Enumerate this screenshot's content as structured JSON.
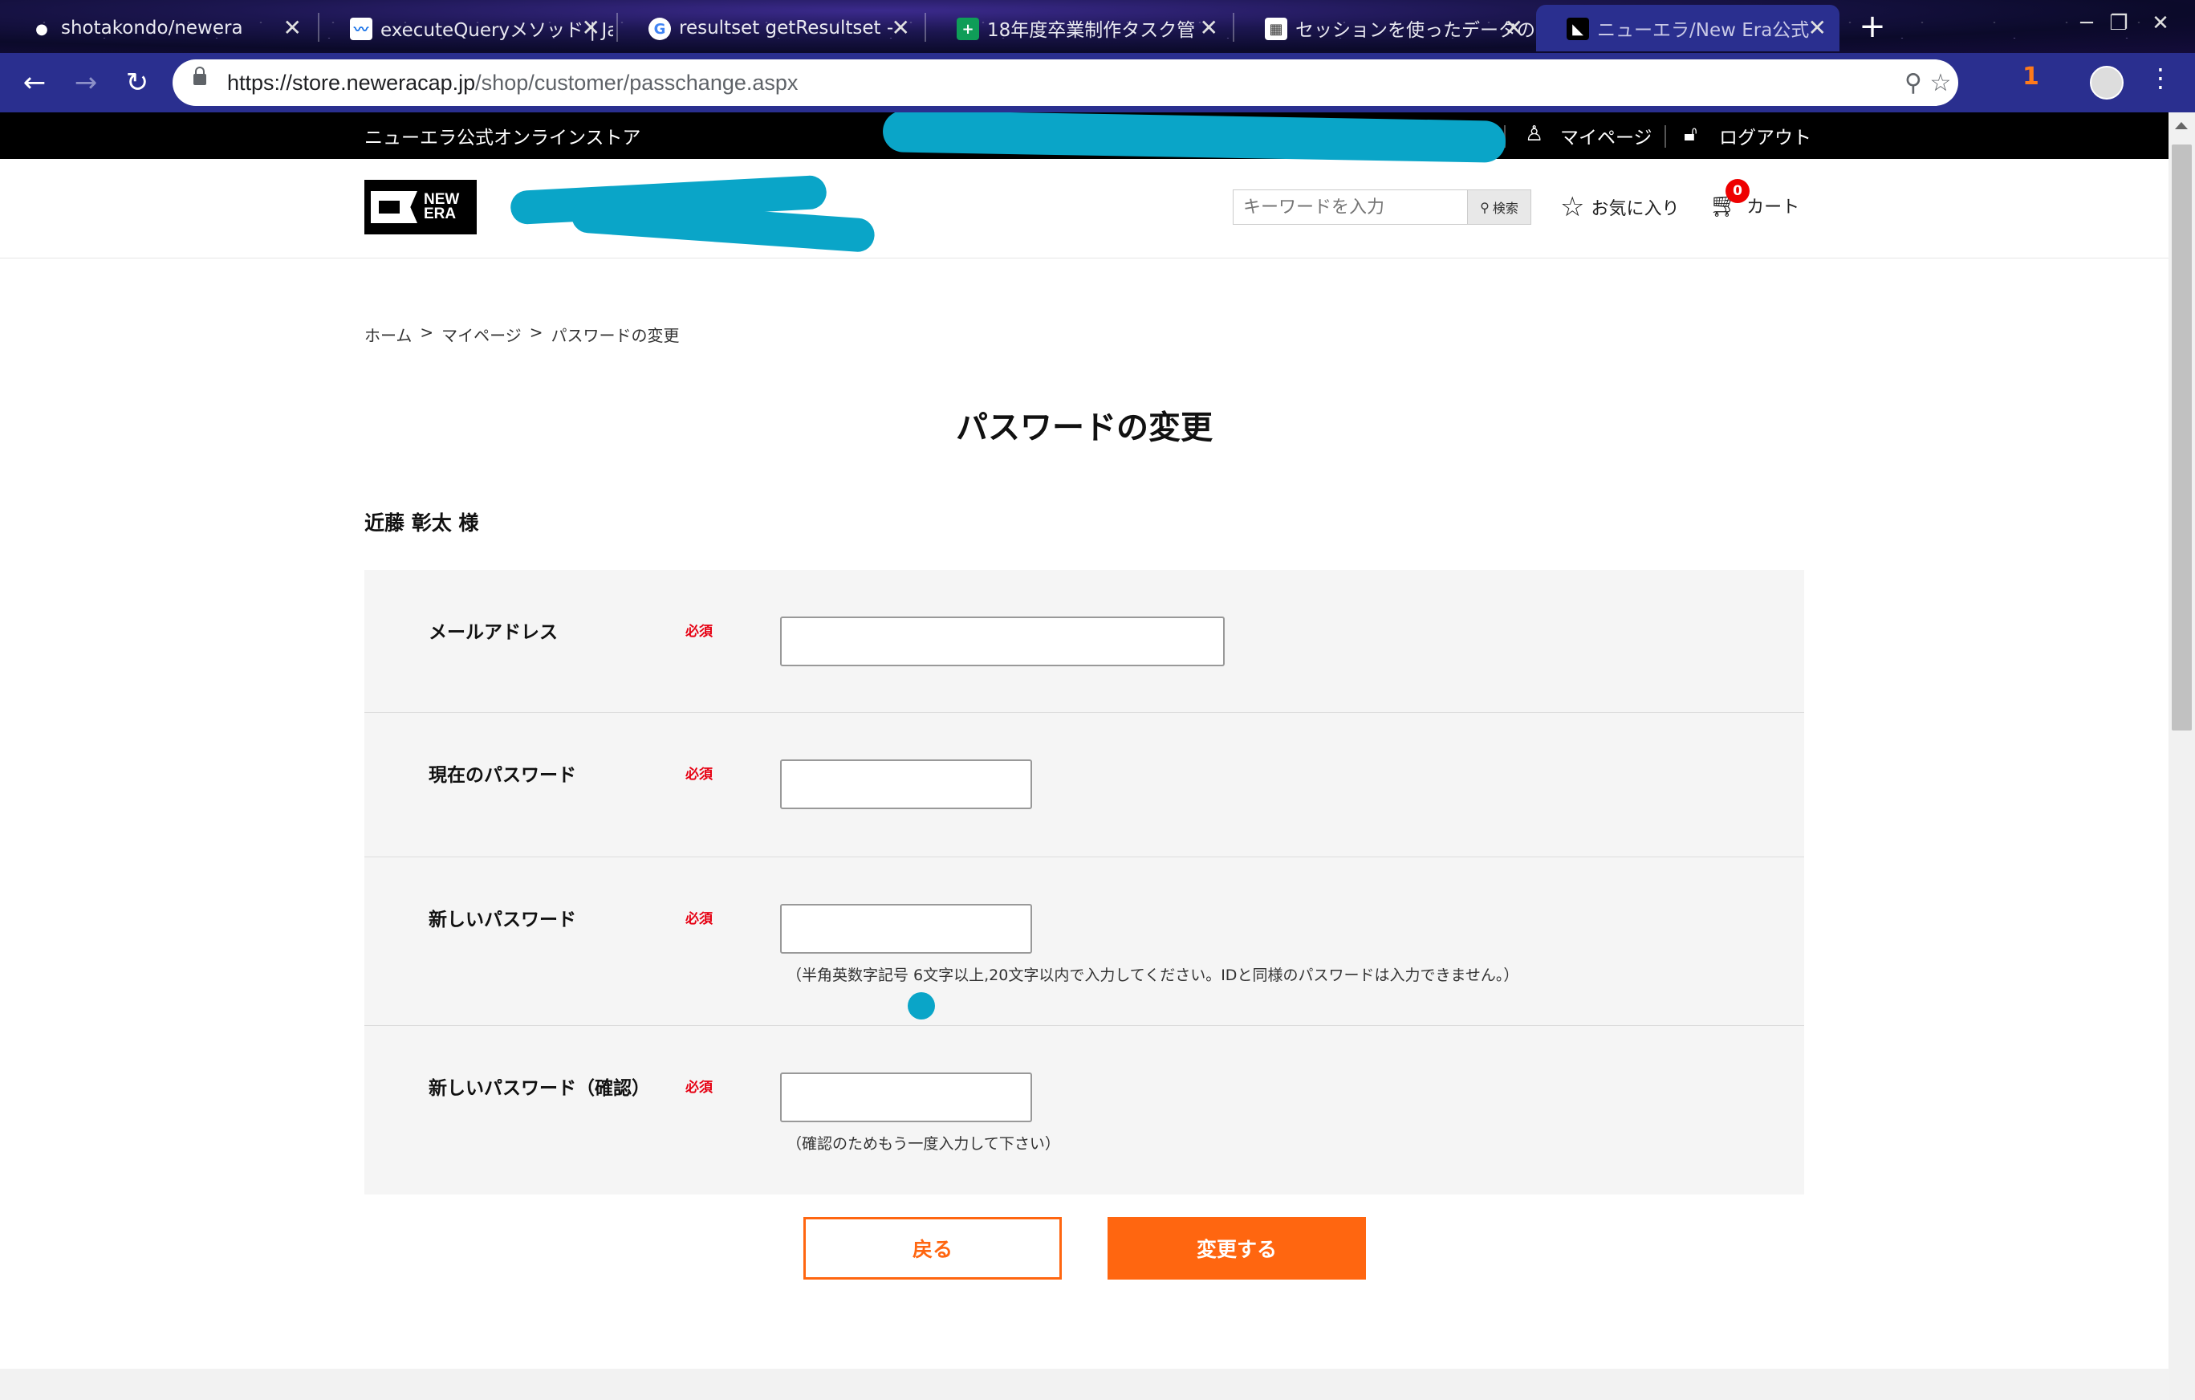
{
  "browser": {
    "tabs": [
      {
        "title": "shotakondo/newera",
        "favicon": "github-icon",
        "favicon_color": "#ffffff",
        "active": false
      },
      {
        "title": "executeQueryメソッド | Ja",
        "favicon": "chart-icon",
        "favicon_color": "#1a73e8",
        "active": false
      },
      {
        "title": "resultset getResultset -",
        "favicon": "google-icon",
        "favicon_color": "#4285f4",
        "active": false
      },
      {
        "title": "18年度卒業制作タスク管",
        "favicon": "sheets-icon",
        "favicon_color": "#0f9d58",
        "active": false
      },
      {
        "title": "セッションを使ったデータの",
        "favicon": "grid-icon",
        "favicon_color": "#ffffff",
        "active": false
      },
      {
        "title": "ニューエラ/New Era公式",
        "favicon": "newera-icon",
        "favicon_color": "#000000",
        "active": true
      }
    ],
    "url_host": "https://store.neweracap.jp",
    "url_path": "/shop/customer/passchange.aspx",
    "extension_badge": "1"
  },
  "site": {
    "store_name": "ニューエラ公式オンラインストア",
    "mypage": "マイページ",
    "logout": "ログアウト",
    "logo_text_top": "NEW",
    "logo_text_bottom": "ERA",
    "search_placeholder": "キーワードを入力",
    "search_button": "検索",
    "favorites": "お気に入り",
    "cart": "カート",
    "cart_count": "0",
    "accent_color": "#ff6610",
    "required_color": "#e60012"
  },
  "breadcrumb": {
    "home": "ホーム",
    "sep": ">",
    "mypage": "マイページ",
    "current": "パスワードの変更"
  },
  "page": {
    "title": "パスワードの変更",
    "username": "近藤 彰太 様"
  },
  "form": {
    "required": "必須",
    "email_label": "メールアドレス",
    "email_value": "",
    "current_password_label": "現在のパスワード",
    "new_password_label": "新しいパスワード",
    "new_password_hint": "（半角英数字記号 6文字以上,20文字以内で入力してください。IDと同様のパスワードは入力できません。）",
    "confirm_password_label": "新しいパスワード（確認）",
    "confirm_password_hint": "（確認のためもう一度入力して下さい）"
  },
  "actions": {
    "back": "戻る",
    "submit": "変更する"
  }
}
